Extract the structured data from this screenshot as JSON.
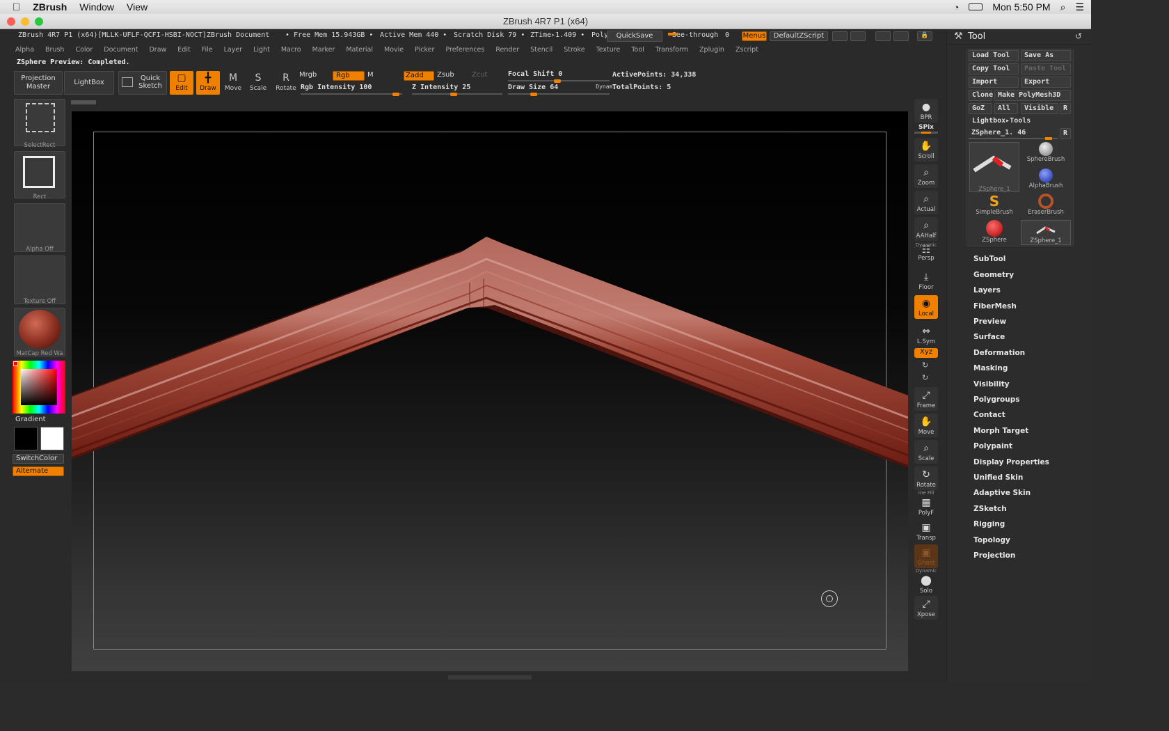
{
  "menubar": {
    "apple": "",
    "app_name": "ZBrush",
    "items": [
      "Window",
      "View"
    ],
    "clock": "Mon 5:50 PM"
  },
  "window": {
    "title": "ZBrush 4R7 P1 (x64)"
  },
  "docline": {
    "doc_title": "ZBrush 4R7 P1 (x64)[MLLK-UFLF-QCFI-HSBI-NOCT]ZBrush Document",
    "free_mem": "• Free Mem 15.943GB •",
    "active_mem": "Active Mem 440 •",
    "scratch": "Scratch Disk 79 •",
    "ztime": "ZTime▹1.409 •",
    "poly": "Poly",
    "quicksave": "QuickSave",
    "seethrough": "See-through",
    "seethrough_value": "0",
    "menus": "Menus",
    "defaultzscript": "DefaultZScript"
  },
  "mainmenu": [
    "Alpha",
    "Brush",
    "Color",
    "Document",
    "Draw",
    "Edit",
    "File",
    "Layer",
    "Light",
    "Macro",
    "Marker",
    "Material",
    "Movie",
    "Picker",
    "Preferences",
    "Render",
    "Stencil",
    "Stroke",
    "Texture",
    "Tool",
    "Transform",
    "Zplugin",
    "Zscript"
  ],
  "status": "ZSphere Preview: Completed.",
  "toolbar": {
    "projection_master": [
      "Projection",
      "Master"
    ],
    "lightbox": "LightBox",
    "quick_sketch": [
      "Quick",
      "Sketch"
    ],
    "edit": "Edit",
    "draw": "Draw",
    "move": "Move",
    "scale": "Scale",
    "rotate": "Rotate",
    "mrgb": "Mrgb",
    "rgb": "Rgb",
    "m": "M",
    "zadd": "Zadd",
    "zsub": "Zsub",
    "zcut": "Zcut",
    "rgb_intensity_label": "Rgb  Intensity",
    "rgb_intensity": "100",
    "z_intensity_label": "Z Intensity",
    "z_intensity": "25",
    "focal_shift_label": "Focal Shift",
    "focal_shift": "0",
    "draw_size_label": "Draw Size",
    "draw_size": "64",
    "dynamic": "Dynamic",
    "active_points": "ActivePoints: 34,338",
    "total_points": "TotalPoints: 5"
  },
  "leftshelf": {
    "select_rect": "SelectRect",
    "rect": "Rect",
    "alpha": "Alpha  Off",
    "texture": "Texture  Off",
    "matcap": "MatCap  Red  Wa",
    "gradient": "Gradient",
    "switch_color": "SwitchColor",
    "alternate": "Alternate"
  },
  "rightshelf": {
    "bpr": "BPR",
    "spix": "SPix",
    "scroll": "Scroll",
    "zoom": "Zoom",
    "actual": "Actual",
    "aahalf": "AAHalf",
    "dynamic": "Dynamic",
    "persp": "Persp",
    "floor": "Floor",
    "local": "Local",
    "lsym": "L.Sym",
    "xyz": "Xyz",
    "frame": "Frame",
    "move": "Move",
    "scale": "Scale",
    "rotate": "Rotate",
    "linefill": "Ine Fill",
    "polyf": "PolyF",
    "transp": "Transp",
    "ghost": "Ghost",
    "dynamic2": "Dynamic",
    "solo": "Solo",
    "xpose": "Xpose"
  },
  "toolpanel": {
    "title": "Tool",
    "load_tool": "Load Tool",
    "save_as": "Save As",
    "copy_tool": "Copy Tool",
    "paste_tool": "Paste Tool",
    "import": "Import",
    "export": "Export",
    "clone": "Clone",
    "make_polymesh": "Make PolyMesh3D",
    "goz": "GoZ",
    "all": "All",
    "visible": "Visible",
    "r": "R",
    "lightbox_tools": "Lightbox▸Tools",
    "current_tool": "ZSphere_1. 46",
    "thumbs": {
      "zsphere_main": "ZSphere_1",
      "sphere_brush": "SphereBrush",
      "alpha_brush": "AlphaBrush",
      "simple_brush": "SimpleBrush",
      "eraser_brush": "EraserBrush",
      "zsphere": "ZSphere",
      "zsphere_1": "ZSphere_1"
    },
    "sections": [
      "SubTool",
      "Geometry",
      "Layers",
      "FiberMesh",
      "Preview",
      "Surface",
      "Deformation",
      "Masking",
      "Visibility",
      "Polygroups",
      "Contact",
      "Morph Target",
      "Polypaint",
      "Display Properties",
      "Unified Skin",
      "Adaptive Skin",
      "ZSketch",
      "Rigging",
      "Topology",
      "Projection"
    ]
  },
  "colors": {
    "accent": "#f08000",
    "model": "#9a3a2c"
  }
}
